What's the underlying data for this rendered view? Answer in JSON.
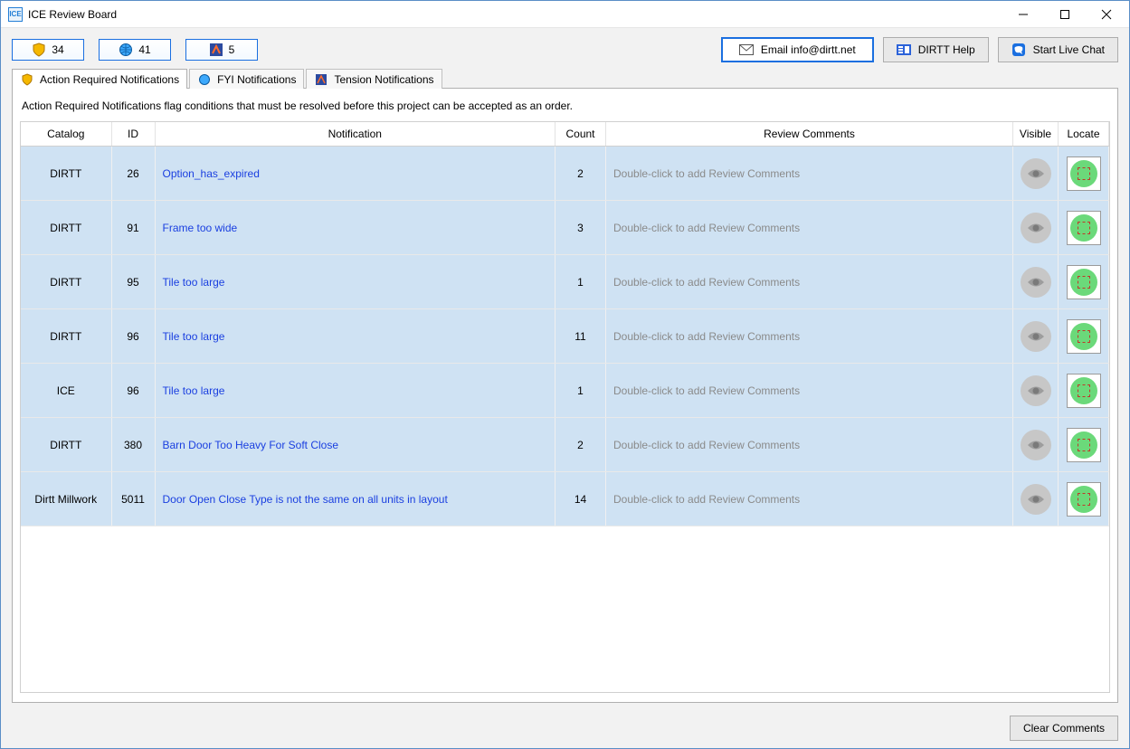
{
  "window": {
    "app_icon_text": "ICE",
    "title": "ICE Review Board"
  },
  "toolbar": {
    "badges": [
      {
        "count": "34",
        "icon": "shield-icon"
      },
      {
        "count": "41",
        "icon": "globe-icon"
      },
      {
        "count": "5",
        "icon": "tension-icon"
      }
    ],
    "email_label": "Email info@dirtt.net",
    "help_label": "DIRTT Help",
    "chat_label": "Start Live Chat"
  },
  "tabs": {
    "action_required": "Action Required Notifications",
    "fyi": "FYI Notifications",
    "tension": "Tension Notifications"
  },
  "panel": {
    "description": "Action Required Notifications flag conditions that must be resolved before this project can be accepted as an order.",
    "columns": {
      "catalog": "Catalog",
      "id": "ID",
      "notification": "Notification",
      "count": "Count",
      "review_comments": "Review Comments",
      "visible": "Visible",
      "locate": "Locate"
    },
    "review_placeholder": "Double-click to add Review Comments",
    "rows": [
      {
        "catalog": "DIRTT",
        "id": "26",
        "notification": "Option_has_expired",
        "count": "2"
      },
      {
        "catalog": "DIRTT",
        "id": "91",
        "notification": "Frame too wide",
        "count": "3"
      },
      {
        "catalog": "DIRTT",
        "id": "95",
        "notification": "Tile too large",
        "count": "1"
      },
      {
        "catalog": "DIRTT",
        "id": "96",
        "notification": "Tile too large",
        "count": "11"
      },
      {
        "catalog": "ICE",
        "id": "96",
        "notification": "Tile too large",
        "count": "1"
      },
      {
        "catalog": "DIRTT",
        "id": "380",
        "notification": "Barn Door Too Heavy For Soft Close",
        "count": "2"
      },
      {
        "catalog": "Dirtt Millwork",
        "id": "5011",
        "notification": "Door Open Close Type is not the same on all units in layout",
        "count": "14"
      }
    ]
  },
  "footer": {
    "clear_comments": "Clear Comments"
  }
}
